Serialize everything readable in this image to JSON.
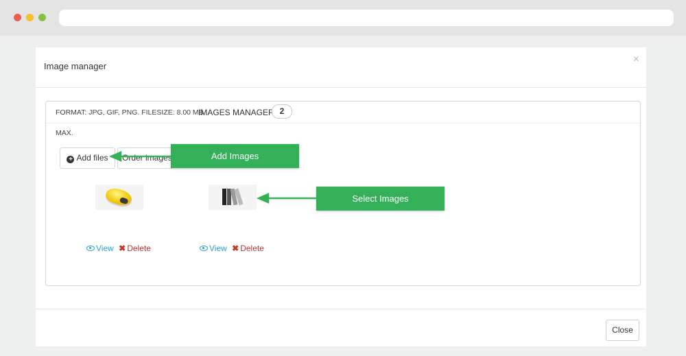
{
  "modal": {
    "title": "Image manager",
    "close_glyph": "×",
    "close_button_label": "Close"
  },
  "panel": {
    "format_text": "FORMAT: JPG, GIF, PNG. FILESIZE: 8.00 MB",
    "manager_title": "IMAGES MANAGER",
    "image_count": "2",
    "max_text": "MAX.",
    "add_files_label": "Add files",
    "order_images_label": "Order images"
  },
  "images": [
    {
      "view_label": "View",
      "delete_label": "Delete",
      "thumb": "yellow-mouse"
    },
    {
      "view_label": "View",
      "delete_label": "Delete",
      "thumb": "books"
    }
  ],
  "callouts": {
    "add_images": "Add Images",
    "select_images": "Select Images",
    "color": "#34b058"
  },
  "colors": {
    "link": "#2a9fd6",
    "delete": "#b33333",
    "callout": "#34b058"
  }
}
